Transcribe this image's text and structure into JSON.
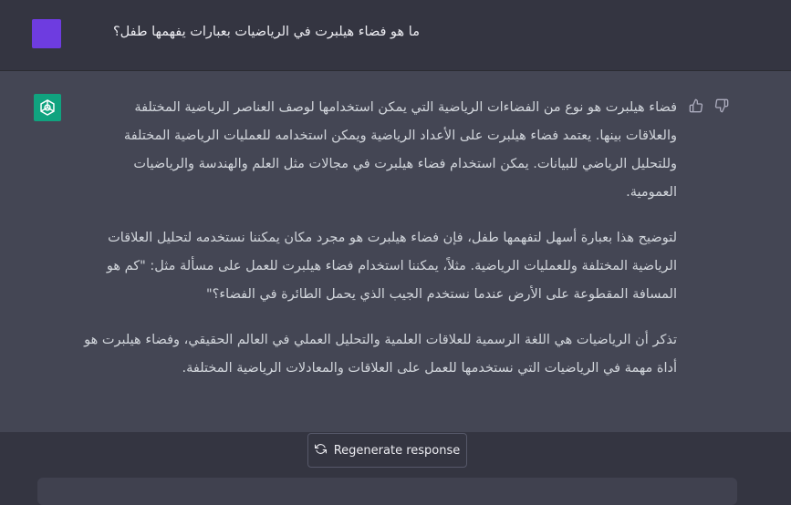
{
  "conversation": {
    "user_message": "ما هو فضاء هيلبرت في الرياضيات بعبارات يفهمها طفل؟",
    "assistant_paragraphs": [
      "فضاء هيلبرت هو نوع من الفضاءات الرياضية التي يمكن استخدامها لوصف العناصر الرياضية المختلفة والعلاقات بينها. يعتمد فضاء هيلبرت على الأعداد الرياضية ويمكن استخدامه للعمليات الرياضية المختلفة وللتحليل الرياضي للبيانات. يمكن استخدام فضاء هيلبرت في مجالات مثل العلم والهندسة والرياضيات العمومية.",
      "لتوضيح هذا بعبارة أسهل لتفهمها طفل، فإن فضاء هيلبرت هو مجرد مكان يمكننا نستخدمه لتحليل العلاقات الرياضية المختلفة وللعمليات الرياضية. مثلاً، يمكننا استخدام فضاء هيلبرت للعمل على مسألة مثل: \"كم هو المسافة المقطوعة على الأرض عندما نستخدم الجيب الذي يحمل الطائرة في الفضاء؟\"",
      "تذكر أن الرياضيات هي اللغة الرسمية للعلاقات العلمية والتحليل العملي في العالم الحقيقي، وفضاء هيلبرت هو أداة مهمة في الرياضيات التي نستخدمها للعمل على العلاقات والمعادلات الرياضية المختلفة."
    ]
  },
  "actions": {
    "regenerate_label": "Regenerate response"
  },
  "icons": {
    "assistant_logo": "openai-logo-icon",
    "thumbs_up": "thumbs-up-icon",
    "thumbs_down": "thumbs-down-icon",
    "regenerate": "refresh-icon"
  },
  "colors": {
    "user_avatar": "#6e3ce0",
    "assistant_avatar": "#10a37f",
    "background": "#343541",
    "assistant_row": "#444654"
  }
}
